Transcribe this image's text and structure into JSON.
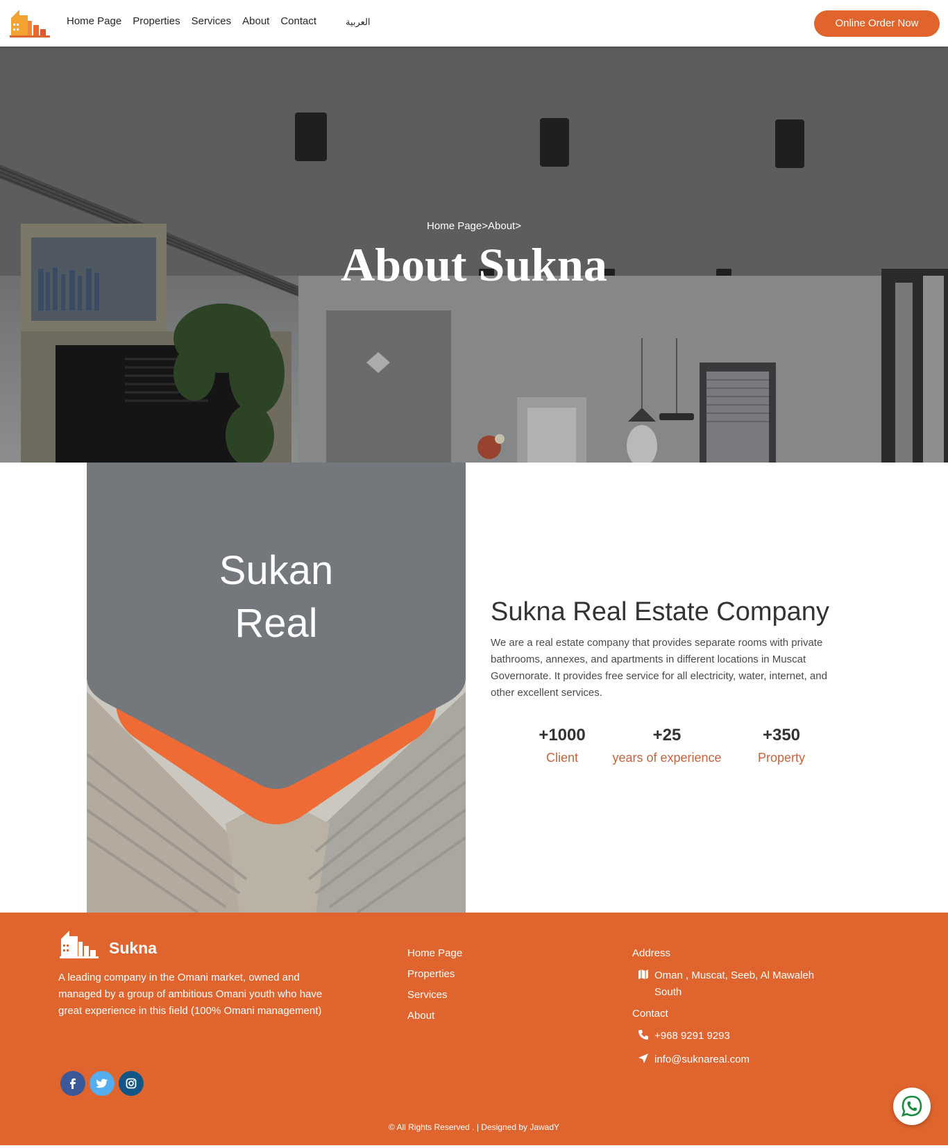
{
  "nav": {
    "links": [
      "Home Page",
      "Properties",
      "Services",
      "About",
      "Contact"
    ],
    "language": "العربية",
    "order_button": "Online Order Now",
    "logo_icon": "building-logo-icon"
  },
  "hero": {
    "breadcrumb": "Home Page>About>",
    "title": "About Sukna"
  },
  "about": {
    "panel_line1": "Sukan",
    "panel_line2": "Real",
    "heading": "Sukna Real Estate Company",
    "description": "We are a real estate company that provides separate rooms with private bathrooms, annexes, and apartments in different locations in Muscat Governorate. It provides free service for all electricity, water, internet, and other excellent services.",
    "stats": [
      {
        "value": "+1000",
        "label": "Client"
      },
      {
        "value": "+25",
        "label": "years of experience"
      },
      {
        "value": "+350",
        "label": "Property"
      }
    ]
  },
  "footer": {
    "brand": "Sukna",
    "description": "A leading company in the Omani market, owned and managed by a group of ambitious Omani youth who have great experience in this field (100% Omani management)",
    "links": [
      "Home Page",
      "Properties",
      "Services",
      "About"
    ],
    "address_heading": "Address",
    "address": "Oman , Muscat, Seeb, Al Mawaleh South",
    "contact_heading": "Contact",
    "phone": "+968 9291 9293",
    "email": "info@suknareal.com",
    "copyright": "© All Rights Reserved . | Designed by JawadY",
    "socials": [
      "facebook-icon",
      "twitter-icon",
      "instagram-icon"
    ]
  },
  "colors": {
    "accent": "#e0642c",
    "footer_bg": "#df642d",
    "panel_gray": "#74777c",
    "stat_label": "#c8623a"
  }
}
